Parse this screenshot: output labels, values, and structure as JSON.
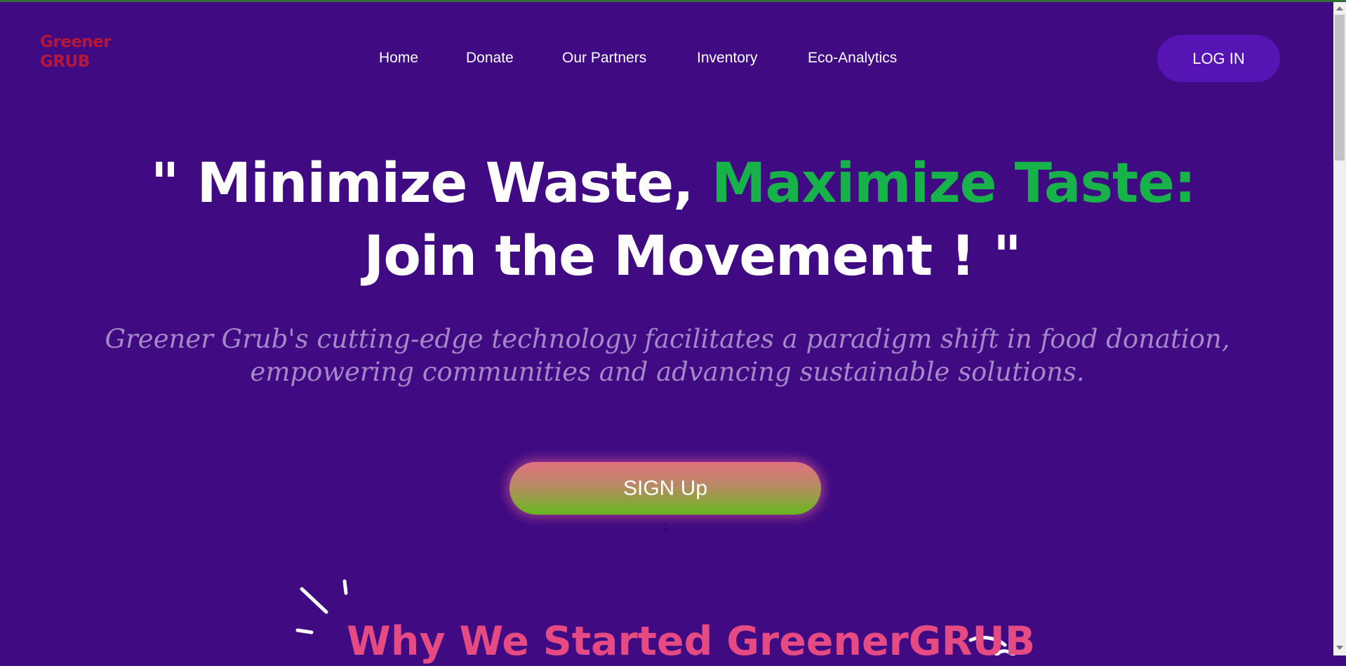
{
  "logo": {
    "line1": "Greener",
    "line2": "GRUB"
  },
  "nav": {
    "items": [
      "Home",
      "Donate",
      "Our Partners",
      "Inventory",
      "Eco-Analytics"
    ]
  },
  "login_label": "LOG IN",
  "hero": {
    "quote_open": "\"",
    "part1": "Minimize Waste,",
    "part2_green": "Maximize Taste:",
    "line2": "Join the Movement !",
    "quote_close": "\"",
    "subtitle": "Greener Grub's cutting-edge technology facilitates a paradigm shift in food donation, empowering communities and advancing sustainable solutions."
  },
  "signup_label": "SIGN Up",
  "section": {
    "title": "Why We Started GreenerGRUB"
  },
  "colors": {
    "background": "#3f0a82",
    "logo": "#b5173b",
    "accent_green": "#17b24a",
    "login_button": "#5614b4",
    "subtitle": "#a488c7",
    "section_title": "#e64a82"
  }
}
